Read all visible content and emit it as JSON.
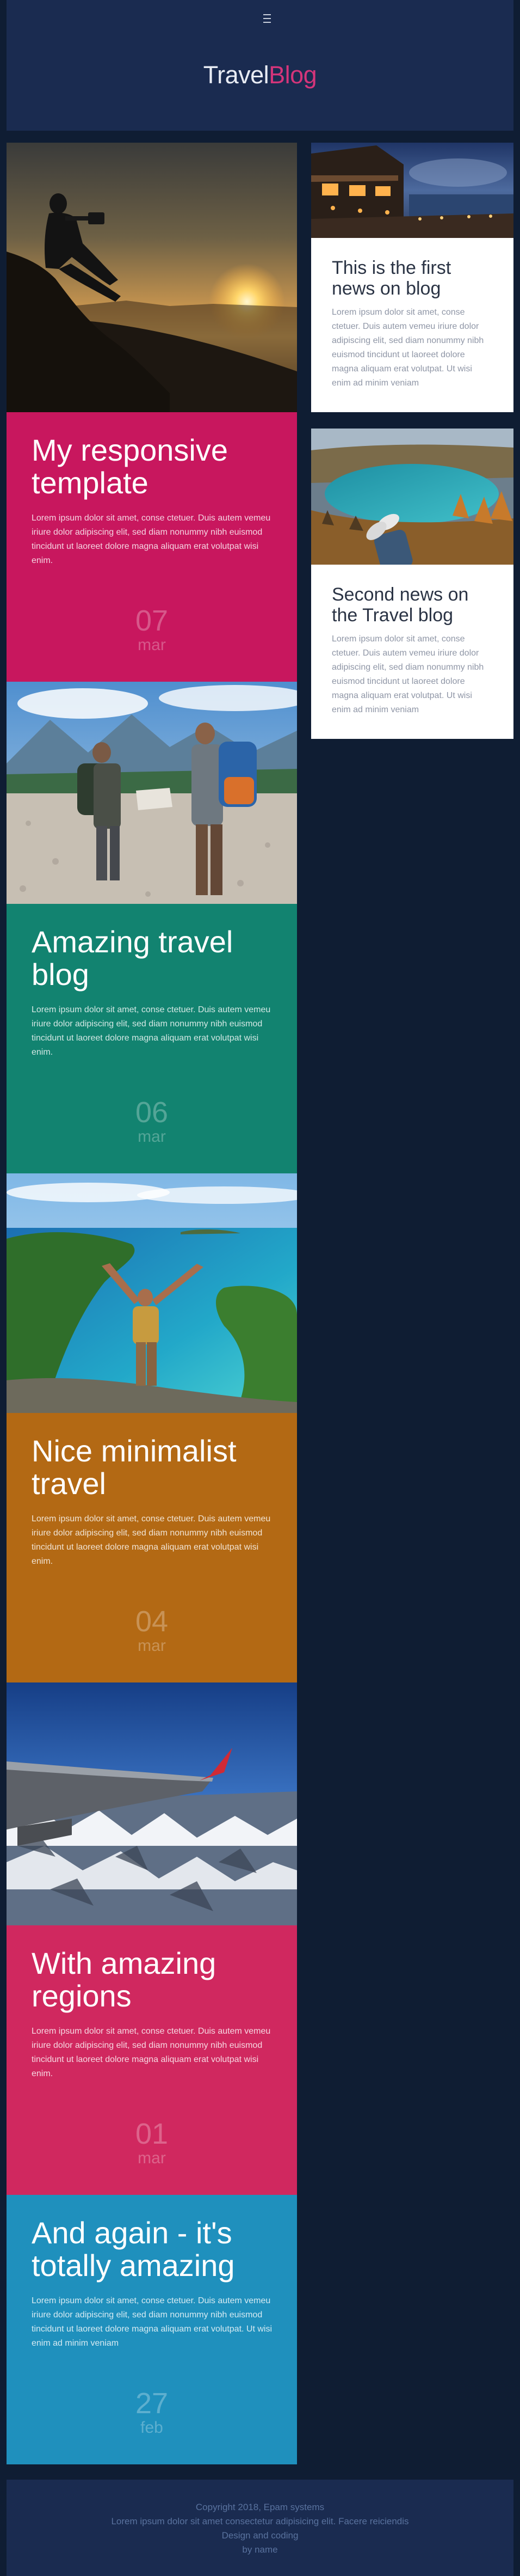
{
  "header": {
    "menu_icon": "hamburger-menu-icon",
    "logo_part1": "Travel",
    "logo_part2": "Blog",
    "logo_color1": "#e8ecf4",
    "logo_color2": "#d4357a"
  },
  "posts": [
    {
      "title": "My responsive template",
      "text": "Lorem ipsum dolor sit amet, conse ctetuer. Duis autem vemeu iriure dolor adipiscing elit, sed diam nonummy nibh euismod tincidunt ut laoreet dolore magna aliquam erat volutpat wisi enim.",
      "day": "07",
      "month": "mar",
      "color": "#c8175e",
      "image": "sunset-photographer-photo"
    },
    {
      "title": "Amazing travel blog",
      "text": "Lorem ipsum dolor sit amet, conse ctetuer. Duis autem vemeu iriure dolor adipiscing elit, sed diam nonummy nibh euismod tincidunt ut laoreet dolore magna aliquam erat volutpat wisi enim.",
      "day": "06",
      "month": "mar",
      "color": "#128370",
      "image": "hikers-map-photo"
    },
    {
      "title": "Nice minimalist travel",
      "text": "Lorem ipsum dolor sit amet, conse ctetuer. Duis autem vemeu iriure dolor adipiscing elit, sed diam nonummy nibh euismod tincidunt ut laoreet dolore magna aliquam erat volutpat wisi enim.",
      "day": "04",
      "month": "mar",
      "color": "#b36914",
      "image": "tropical-island-photo"
    },
    {
      "title": "With amazing regions",
      "text": "Lorem ipsum dolor sit amet, conse ctetuer. Duis autem vemeu iriure dolor adipiscing elit, sed diam nonummy nibh euismod tincidunt ut laoreet dolore magna aliquam erat volutpat wisi enim.",
      "day": "01",
      "month": "mar",
      "color": "#d0285f",
      "image": "airplane-wing-photo"
    },
    {
      "title": "And again - it's totally amazing",
      "text": "Lorem ipsum dolor sit amet, conse ctetuer. Duis autem vemeu iriure dolor adipiscing elit, sed diam nonummy nibh euismod tincidunt ut laoreet dolore magna aliquam erat volutpat. Ut wisi enim ad minim veniam",
      "day": "27",
      "month": "feb",
      "color": "#1f90bd"
    }
  ],
  "news": [
    {
      "title": "This is the first news on blog",
      "text": "Lorem ipsum dolor sit amet, conse ctetuer. Duis autem vemeu iriure dolor adipiscing elit, sed diam nonummy nibh euismod tincidunt ut laoreet dolore magna aliquam erat volutpat. Ut wisi enim ad minim veniam",
      "image": "resort-dusk-photo"
    },
    {
      "title": "Second news on the Travel blog",
      "text": "Lorem ipsum dolor sit amet, conse ctetuer. Duis autem vemeu iriure dolor adipiscing elit, sed diam nonummy nibh euismod tincidunt ut laoreet dolore magna aliquam erat volutpat. Ut wisi enim ad minim veniam",
      "image": "mountain-lake-photo"
    }
  ],
  "footer": {
    "line1": "Copyright 2018, Epam systems",
    "line2": "Lorem ipsum dolor sit amet consectetur adipisicing elit. Facere reiciendis",
    "line3": "Design and coding",
    "line4": "by name"
  }
}
